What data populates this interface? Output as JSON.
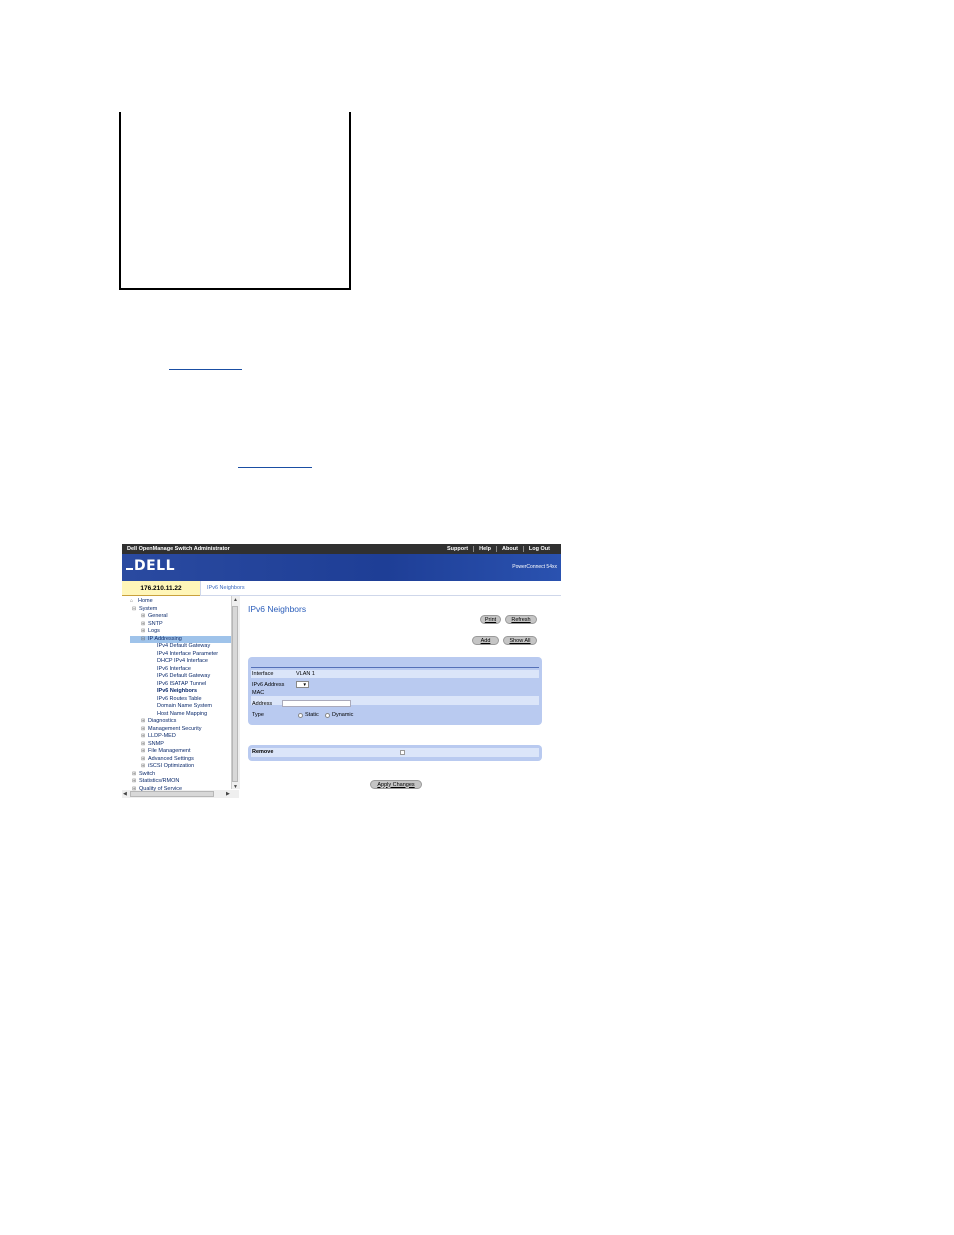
{
  "app": {
    "title": "Dell OpenManage Switch Administrator",
    "nav": [
      "Support",
      "Help",
      "About",
      "Log Out"
    ],
    "logo": "DELL",
    "product": "PowerConnect 54xx",
    "ip": "176.210.11.22",
    "breadcrumb": "IPv6 Neighbors"
  },
  "tree": {
    "items": [
      {
        "label": "Home",
        "expander": ""
      },
      {
        "label": "System",
        "expander": "⊟"
      },
      {
        "label": "General",
        "expander": "⊞"
      },
      {
        "label": "SNTP",
        "expander": "⊞"
      },
      {
        "label": "Logs",
        "expander": "⊞"
      },
      {
        "label": "IP Addressing",
        "expander": "⊟"
      },
      {
        "label": "IPv4 Default Gateway",
        "expander": ""
      },
      {
        "label": "IPv4 Interface Parameter",
        "expander": ""
      },
      {
        "label": "DHCP IPv4 Interface",
        "expander": ""
      },
      {
        "label": "IPv6 Interface",
        "expander": ""
      },
      {
        "label": "IPv6 Default Gateway",
        "expander": ""
      },
      {
        "label": "IPv6 ISATAP Tunnel",
        "expander": ""
      },
      {
        "label": "IPv6 Neighbors",
        "expander": ""
      },
      {
        "label": "IPv6 Routes Table",
        "expander": ""
      },
      {
        "label": "Domain Name System",
        "expander": ""
      },
      {
        "label": "Host Name Mapping",
        "expander": ""
      },
      {
        "label": "Diagnostics",
        "expander": "⊞"
      },
      {
        "label": "Management Security",
        "expander": "⊞"
      },
      {
        "label": "LLDP-MED",
        "expander": "⊞"
      },
      {
        "label": "SNMP",
        "expander": "⊞"
      },
      {
        "label": "File Management",
        "expander": "⊞"
      },
      {
        "label": "Advanced Settings",
        "expander": "⊞"
      },
      {
        "label": "iSCSI Optimization",
        "expander": "⊞"
      },
      {
        "label": "Switch",
        "expander": "⊞"
      },
      {
        "label": "Statistics/RMON",
        "expander": "⊞"
      },
      {
        "label": "Quality of Service",
        "expander": "⊞"
      }
    ],
    "selected": "IPv6 Neighbors"
  },
  "main": {
    "title": "IPv6 Neighbors",
    "buttons": {
      "print": "Print",
      "refresh": "Refresh",
      "add": "Add",
      "show_all": "Show All",
      "apply": "Apply Changes"
    },
    "form": {
      "interface_label": "Interface",
      "interface_value": "VLAN 1",
      "ipv6_address_label": "IPv6 Address",
      "mac_label": "MAC",
      "address_label": "Address",
      "mac_value": "",
      "type_label": "Type",
      "type_options": [
        "Static",
        "Dynamic"
      ]
    },
    "remove_label": "Remove"
  }
}
